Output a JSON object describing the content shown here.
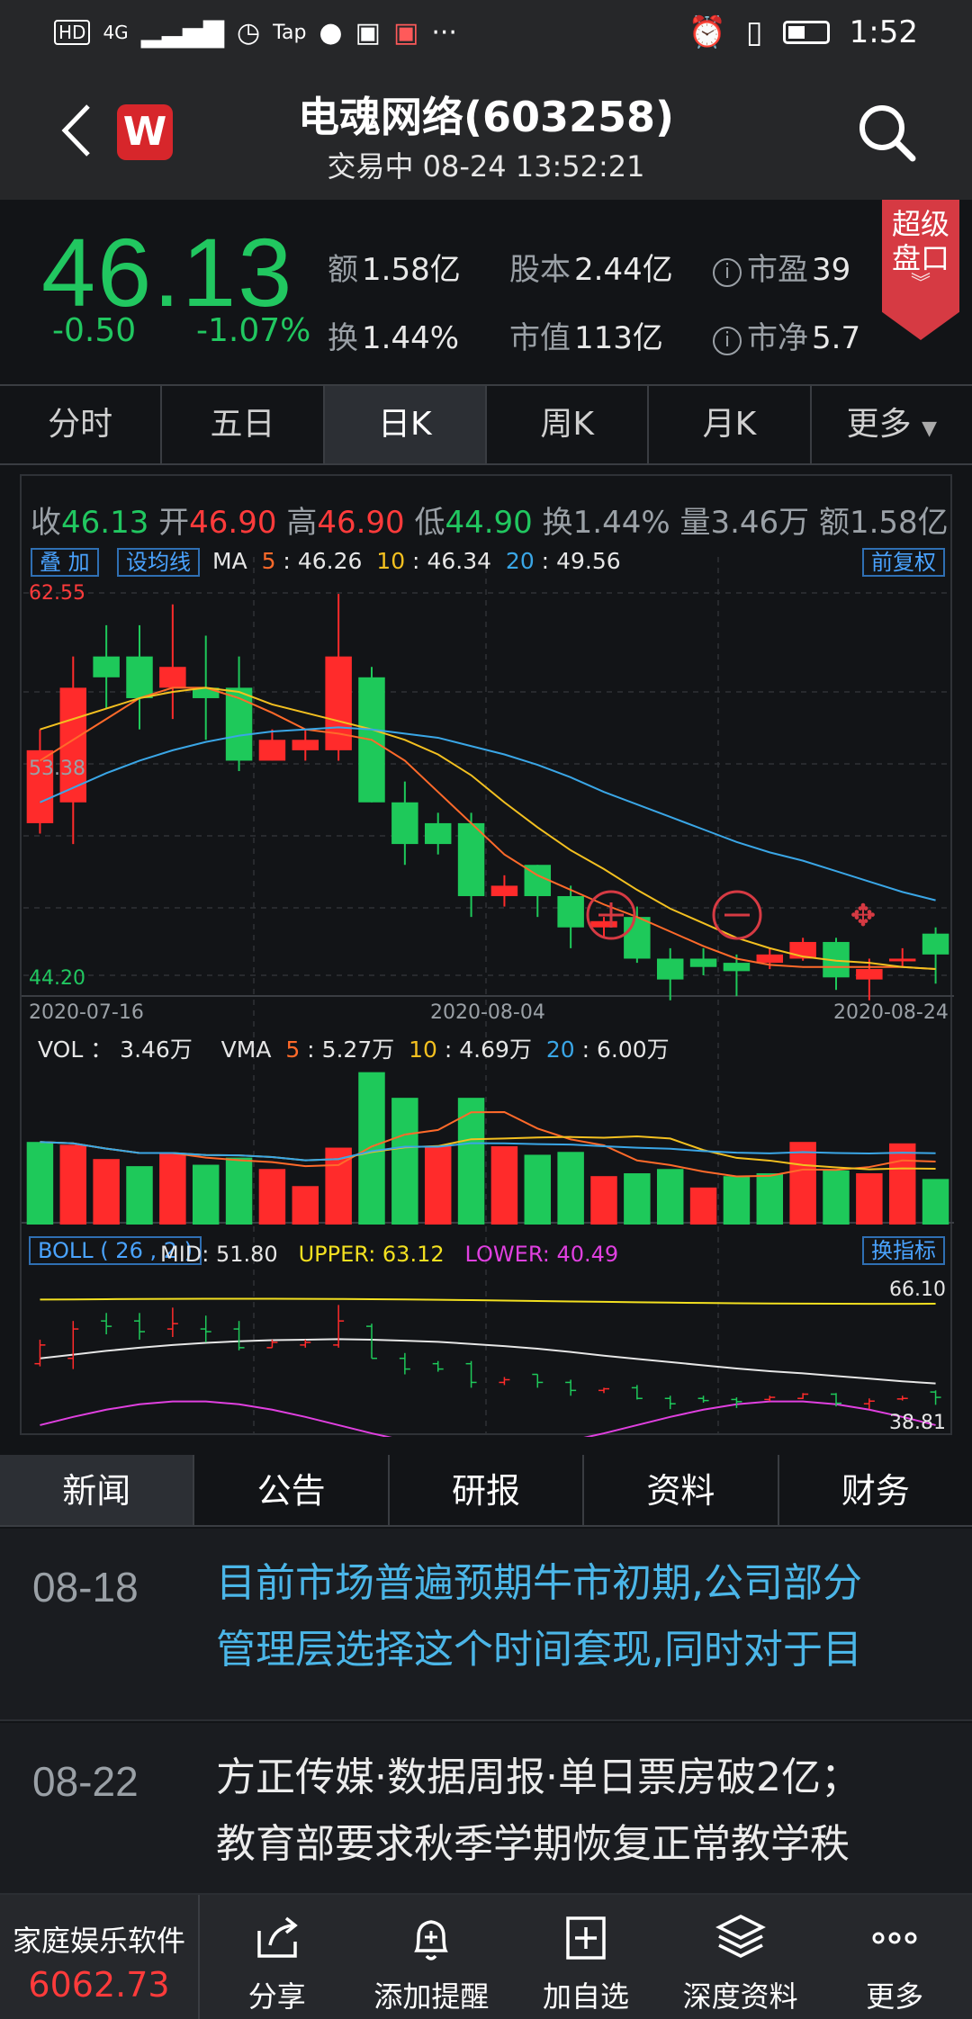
{
  "status": {
    "left_icons": [
      "HD",
      "4G",
      "Tap"
    ],
    "time": "1:52"
  },
  "header": {
    "title": "电魂网络(603258)",
    "subtitle": "交易中 08-24 13:52:21",
    "logo": "W"
  },
  "quote": {
    "price": "46.13",
    "change": "-0.50",
    "change_pct": "-1.07%",
    "cells": [
      {
        "label": "额",
        "value": "1.58亿"
      },
      {
        "label": "换",
        "value": "1.44%"
      },
      {
        "label": "股本",
        "value": "2.44亿"
      },
      {
        "label": "市值",
        "value": "113亿"
      },
      {
        "label": "市盈",
        "value": "39"
      },
      {
        "label": "市净",
        "value": "5.7"
      }
    ],
    "super_button": {
      "line1": "超级",
      "line2": "盘口"
    }
  },
  "period_tabs": [
    "分时",
    "五日",
    "日K",
    "周K",
    "月K",
    "更多"
  ],
  "chart": {
    "ohlc": {
      "close_label": "收",
      "close": "46.13",
      "open_label": "开",
      "open": "46.90",
      "high_label": "高",
      "high": "46.90",
      "low_label": "低",
      "low": "44.90",
      "turnover_label": "换",
      "turnover": "1.44%",
      "vol_label": "量",
      "vol": "3.46万",
      "amount_label": "额",
      "amount": "1.58亿"
    },
    "buttons": {
      "overlay": "叠 加",
      "set_ma": "设均线",
      "adjust": "前复权",
      "switch_indicator": "换指标"
    },
    "ma": {
      "label": "MA",
      "k5": "5",
      "v5": "46.26",
      "k10": "10",
      "v10": "46.34",
      "k20": "20",
      "v20": "49.56"
    },
    "y_labels": {
      "top": "62.55",
      "mid": "53.38",
      "bottom": "44.20"
    },
    "x_labels": [
      "2020-07-16",
      "2020-08-04",
      "2020-08-24"
    ],
    "vol": {
      "label": "VOL ：",
      "value": "3.46万",
      "vma": "VMA",
      "k5": "5",
      "v5": "5.27万",
      "k10": "10",
      "v10": "4.69万",
      "k20": "20",
      "v20": "6.00万"
    },
    "boll": {
      "label": "BOLL ( 26 , 2 )",
      "mid": "MID: 51.80",
      "upper": "UPPER: 63.12",
      "lower": "LOWER: 40.49",
      "top_val": "66.10",
      "bottom_val": "38.81"
    }
  },
  "chart_data": {
    "type": "bar",
    "candles": [
      {
        "o": 51.5,
        "c": 55.0,
        "h": 56.0,
        "l": 51.0
      },
      {
        "o": 52.5,
        "c": 58.0,
        "h": 59.5,
        "l": 50.5
      },
      {
        "o": 59.5,
        "c": 58.5,
        "h": 61.0,
        "l": 57.0
      },
      {
        "o": 59.5,
        "c": 57.5,
        "h": 61.0,
        "l": 56.0
      },
      {
        "o": 58.0,
        "c": 59.0,
        "h": 62.0,
        "l": 56.5
      },
      {
        "o": 58.0,
        "c": 57.5,
        "h": 60.5,
        "l": 55.5
      },
      {
        "o": 58.0,
        "c": 54.5,
        "h": 59.5,
        "l": 54.0
      },
      {
        "o": 54.5,
        "c": 55.5,
        "h": 56.0,
        "l": 54.5
      },
      {
        "o": 55.0,
        "c": 55.5,
        "h": 56.0,
        "l": 54.5
      },
      {
        "o": 55.0,
        "c": 59.5,
        "h": 62.5,
        "l": 54.5
      },
      {
        "o": 58.5,
        "c": 52.5,
        "h": 59.0,
        "l": 52.5
      },
      {
        "o": 52.5,
        "c": 50.5,
        "h": 53.5,
        "l": 49.5
      },
      {
        "o": 51.5,
        "c": 50.5,
        "h": 52.0,
        "l": 50.0
      },
      {
        "o": 51.5,
        "c": 48.0,
        "h": 52.0,
        "l": 47.0
      },
      {
        "o": 48.0,
        "c": 48.5,
        "h": 49.0,
        "l": 47.5
      },
      {
        "o": 49.5,
        "c": 48.0,
        "h": 49.5,
        "l": 47.0
      },
      {
        "o": 48.0,
        "c": 46.5,
        "h": 48.5,
        "l": 45.5
      },
      {
        "o": 46.5,
        "c": 46.8,
        "h": 47.0,
        "l": 46.0
      },
      {
        "o": 47.0,
        "c": 45.0,
        "h": 47.5,
        "l": 44.8
      },
      {
        "o": 45.0,
        "c": 44.0,
        "h": 45.5,
        "l": 43.0
      },
      {
        "o": 45.0,
        "c": 44.6,
        "h": 45.5,
        "l": 44.2
      },
      {
        "o": 44.8,
        "c": 44.4,
        "h": 45.2,
        "l": 43.2
      },
      {
        "o": 44.8,
        "c": 45.2,
        "h": 45.5,
        "l": 44.5
      },
      {
        "o": 45.0,
        "c": 45.8,
        "h": 46.0,
        "l": 44.9
      },
      {
        "o": 45.8,
        "c": 44.1,
        "h": 46.0,
        "l": 43.5
      },
      {
        "o": 44.0,
        "c": 44.5,
        "h": 45.0,
        "l": 43.0
      },
      {
        "o": 44.9,
        "c": 45.0,
        "h": 45.5,
        "l": 44.6
      },
      {
        "o": 46.2,
        "c": 45.2,
        "h": 46.5,
        "l": 43.8
      }
    ],
    "ma5": [
      54.5,
      55.5,
      56.5,
      57.5,
      58.0,
      58.0,
      57.5,
      56.8,
      56.0,
      55.8,
      55.5,
      54.5,
      53.0,
      51.5,
      50.0,
      49.0,
      48.3,
      47.6,
      47.0,
      46.3,
      45.6,
      45.0,
      44.7,
      44.6,
      44.6,
      44.6,
      44.6,
      44.5
    ],
    "ma10": [
      56.0,
      56.5,
      57.0,
      57.5,
      57.8,
      58.0,
      57.8,
      57.2,
      56.8,
      56.4,
      56.0,
      55.5,
      54.8,
      53.8,
      52.5,
      51.3,
      50.2,
      49.3,
      48.3,
      47.4,
      46.7,
      46.0,
      45.5,
      45.1,
      44.9,
      44.8,
      44.6,
      44.5
    ],
    "ma20": [
      52.5,
      53.2,
      53.9,
      54.5,
      55.0,
      55.4,
      55.7,
      55.9,
      56.0,
      56.1,
      56.0,
      55.8,
      55.6,
      55.2,
      54.8,
      54.3,
      53.7,
      53.0,
      52.4,
      51.8,
      51.2,
      50.6,
      50.1,
      49.7,
      49.2,
      48.7,
      48.2,
      47.8
    ],
    "volumes": [
      5.8,
      5.6,
      4.6,
      4.1,
      5.0,
      4.2,
      4.7,
      3.9,
      2.7,
      5.4,
      10.7,
      8.9,
      5.5,
      8.9,
      5.5,
      4.9,
      5.1,
      3.4,
      3.6,
      3.9,
      2.6,
      3.4,
      3.6,
      5.8,
      3.8,
      3.6,
      5.7,
      3.2
    ],
    "vol_up": [
      false,
      true,
      true,
      false,
      true,
      false,
      false,
      true,
      true,
      true,
      false,
      false,
      true,
      false,
      true,
      false,
      false,
      true,
      false,
      false,
      true,
      false,
      false,
      true,
      false,
      true,
      true,
      false
    ],
    "ylim": [
      44.2,
      62.55
    ],
    "vol_max": 11.5
  },
  "news_tabs": [
    "新闻",
    "公告",
    "研报",
    "资料",
    "财务"
  ],
  "news": [
    {
      "date": "08-18",
      "line1": "目前市场普遍预期牛市初期,公司部分",
      "line2": "管理层选择这个时间套现,同时对于目"
    },
    {
      "date": "08-22",
      "line1": "方正传媒·数据周报·单日票房破2亿；",
      "line2": "教育部要求秋季学期恢复正常教学秩"
    }
  ],
  "bottom": {
    "index_name": "家庭娱乐软件",
    "index_value": "6062.73",
    "items": [
      {
        "icon": "share-icon",
        "label": "分享"
      },
      {
        "icon": "bell-plus-icon",
        "label": "添加提醒"
      },
      {
        "icon": "add-square-icon",
        "label": "加自选"
      },
      {
        "icon": "layers-icon",
        "label": "深度资料"
      },
      {
        "icon": "more-dots-icon",
        "label": "更多"
      }
    ]
  }
}
